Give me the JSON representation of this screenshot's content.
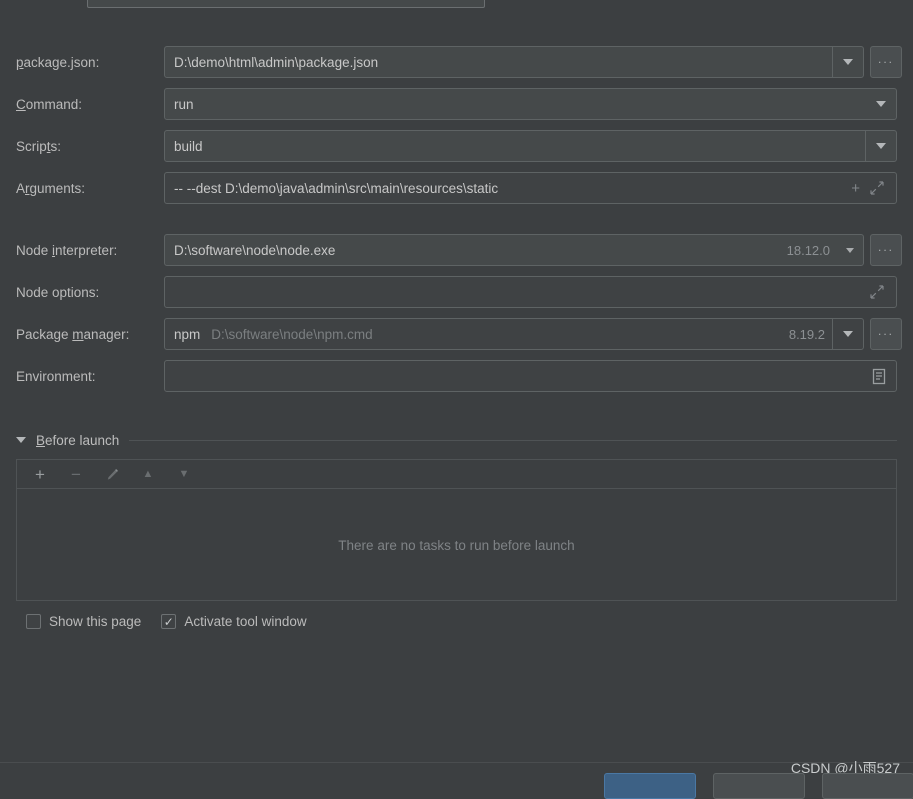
{
  "window": {
    "background": "#3c3f41",
    "accent": "#3d6185"
  },
  "top_partial_field": {
    "name": "name-field-cut-off",
    "value": ""
  },
  "form": {
    "rows": [
      {
        "id": "package-json",
        "label_pre": "",
        "label_mnemonic": "p",
        "label_post": "ackage.json:",
        "value": "D:\\demo\\html\\admin\\package.json",
        "has_dropdown": true,
        "has_browse": true
      },
      {
        "id": "command",
        "label_pre": "",
        "label_mnemonic": "C",
        "label_post": "ommand:",
        "value": "run",
        "has_dropdown": true,
        "has_browse": false
      },
      {
        "id": "scripts",
        "label_pre": "Scrip",
        "label_mnemonic": "t",
        "label_post": "s:",
        "value": "build",
        "has_dropdown": true,
        "has_browse": false
      },
      {
        "id": "arguments",
        "label_pre": "A",
        "label_mnemonic": "r",
        "label_post": "guments:",
        "value": "-- --dest  D:\\demo\\java\\admin\\src\\main\\resources\\static",
        "icons": [
          "plus-icon",
          "expand-icon"
        ]
      },
      {
        "id": "node-interpreter",
        "label_pre": "Node ",
        "label_mnemonic": "i",
        "label_post": "nterpreter:",
        "value": "D:\\software\\node\\node.exe",
        "version": "18.12.0",
        "has_dropdown": true,
        "has_browse": true
      },
      {
        "id": "node-options",
        "label_pre": "Node options:",
        "label_mnemonic": "",
        "label_post": "",
        "value": "",
        "icons": [
          "expand-icon"
        ]
      },
      {
        "id": "package-manager",
        "label_pre": "Package ",
        "label_mnemonic": "m",
        "label_post": "anager:",
        "value": "npm",
        "path_hint": "D:\\software\\node\\npm.cmd",
        "version": "8.19.2",
        "has_dropdown": true,
        "has_browse": true
      },
      {
        "id": "environment",
        "label_pre": "Environment:",
        "label_mnemonic": "",
        "label_post": "",
        "value": "",
        "icons": [
          "environment-list-icon"
        ]
      }
    ],
    "browse_label": "..."
  },
  "before_launch": {
    "collapse_icon": "triangle-down-icon",
    "title_pre": "",
    "title_mnemonic": "B",
    "title_post": "efore launch",
    "toolbar": [
      {
        "name": "add-task-button",
        "glyph": "+",
        "enabled": true
      },
      {
        "name": "remove-task-button",
        "glyph": "−",
        "enabled": false
      },
      {
        "name": "edit-task-button",
        "glyph": "✎",
        "enabled": false
      },
      {
        "name": "move-up-button",
        "glyph": "▲",
        "enabled": false
      },
      {
        "name": "move-down-button",
        "glyph": "▼",
        "enabled": false
      }
    ],
    "empty_text": "There are no tasks to run before launch"
  },
  "checkboxes": [
    {
      "id": "show-this-page",
      "label": "Show this page",
      "checked": false,
      "mark": ""
    },
    {
      "id": "activate-tool-window",
      "label": "Activate tool window",
      "checked": true,
      "mark": "✓"
    }
  ],
  "footer": {
    "watermark": "CSDN @小雨527",
    "buttons": [
      {
        "id": "ok-button",
        "label": "",
        "primary": true
      },
      {
        "id": "cancel-button",
        "label": "",
        "primary": false
      },
      {
        "id": "apply-button",
        "label": "",
        "primary": false
      }
    ]
  }
}
